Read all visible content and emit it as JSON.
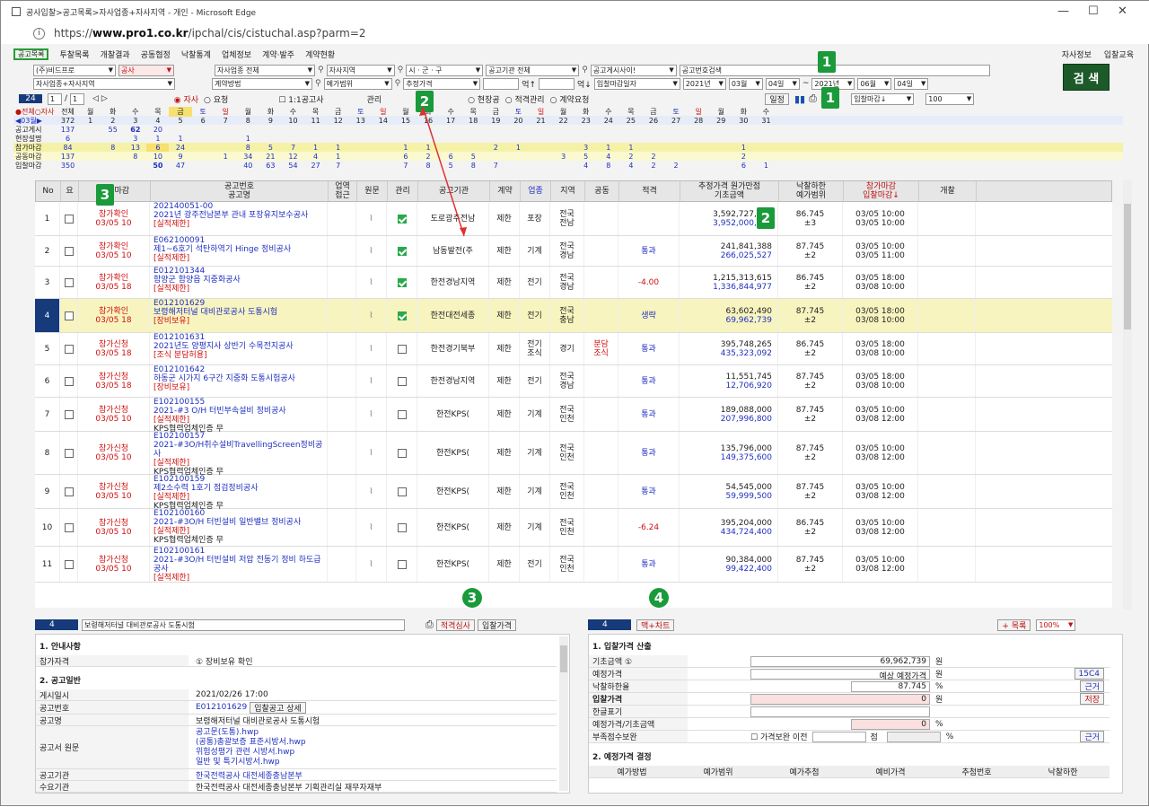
{
  "window": {
    "title": "공사입찰>공고목록>자사업종+자사지역 - 개인 - Microsoft Edge",
    "url_prefix": "https://",
    "url_host": "www.pro1.co.kr",
    "url_path": "/ipchal/cis/cistuchal.asp?parm=2"
  },
  "menu": [
    "공고목록",
    "투찰목록",
    "개찰결과",
    "공동협정",
    "낙찰통계",
    "업체정보",
    "계약·발주",
    "계약현황"
  ],
  "menu_right": [
    "자사정보",
    "입찰교육"
  ],
  "filters_row1": [
    "(주)비드프로",
    "공사",
    "자사업종 전체",
    "자사지역",
    "시 · 군 · 구",
    "공고기관 전체",
    "공고게시사이!",
    "공고번호검색"
  ],
  "filters_row2": [
    "자사업종+자사지역",
    "계약방법",
    "예가범위",
    "추정가격",
    "억↑",
    "억↓",
    "입찰마감일자",
    "2021년",
    "03월",
    "04일",
    "~",
    "2021년",
    "06월",
    "04일"
  ],
  "search_label": "검 색",
  "toolbar": {
    "count": "24",
    "page": "1",
    "pages": "1",
    "nav": "◁ ▷",
    "radio1": "자사",
    "radio2": "요청",
    "check1": "1:1공고사",
    "check2": "관리",
    "radio3": "현장공",
    "radio4": "적격관리",
    "radio5": "계약요청",
    "schedule": "일정",
    "sort": "입찰마감↓",
    "size": "100"
  },
  "badges": {
    "b1": "1",
    "b2": "2",
    "b3": "3",
    "b4": "4"
  },
  "calendar": {
    "dow": [
      "●전체○자사",
      "전체",
      "월",
      "화",
      "수",
      "목",
      "금",
      "토",
      "일",
      "월",
      "화",
      "수",
      "목",
      "금",
      "토",
      "일",
      "월",
      "화",
      "수",
      "목",
      "금",
      "토",
      "일",
      "월",
      "화",
      "수",
      "목",
      "금",
      "토",
      "일",
      "월",
      "화",
      "수"
    ],
    "days": [
      "◀03월▶",
      "372",
      "1",
      "2",
      "3",
      "4",
      "5",
      "6",
      "7",
      "8",
      "9",
      "10",
      "11",
      "12",
      "13",
      "14",
      "15",
      "16",
      "17",
      "18",
      "19",
      "20",
      "21",
      "22",
      "23",
      "24",
      "25",
      "26",
      "27",
      "28",
      "29",
      "30",
      "31"
    ],
    "rows": [
      {
        "label": "공고게시",
        "cells": [
          "137",
          "",
          "55",
          "62",
          "20",
          "",
          "",
          "",
          "",
          "",
          "",
          "",
          "",
          "",
          "",
          "",
          "",
          "",
          "",
          "",
          "",
          "",
          "",
          "",
          "",
          "",
          "",
          "",
          "",
          "",
          "",
          ""
        ]
      },
      {
        "label": "현장설명",
        "cells": [
          "6",
          "",
          "",
          "3",
          "1",
          "1",
          "",
          "",
          "1",
          "",
          "",
          "",
          "",
          "",
          "",
          "",
          "",
          "",
          "",
          "",
          "",
          "",
          "",
          "",
          "",
          "",
          "",
          "",
          "",
          "",
          "",
          ""
        ]
      },
      {
        "label": "참가마감",
        "cells": [
          "84",
          "",
          "8",
          "13",
          "6",
          "24",
          "",
          "",
          "8",
          "5",
          "7",
          "1",
          "1",
          "",
          "",
          "1",
          "1",
          "",
          "",
          "2",
          "1",
          "",
          "",
          "3",
          "1",
          "1",
          "",
          "",
          "",
          "",
          "1",
          ""
        ]
      },
      {
        "label": "공동마감",
        "cells": [
          "137",
          "",
          "",
          "8",
          "10",
          "9",
          "",
          "1",
          "34",
          "21",
          "12",
          "4",
          "1",
          "",
          "",
          "6",
          "2",
          "6",
          "5",
          "",
          "",
          "",
          "3",
          "5",
          "4",
          "2",
          "2",
          "",
          "",
          "",
          "2",
          ""
        ]
      },
      {
        "label": "입찰마감",
        "cells": [
          "350",
          "",
          "",
          "",
          "50",
          "47",
          "",
          "",
          "40",
          "63",
          "54",
          "27",
          "7",
          "",
          "",
          "7",
          "8",
          "5",
          "8",
          "7",
          "",
          "",
          "",
          "4",
          "8",
          "4",
          "2",
          "2",
          "",
          "",
          "6",
          "1"
        ]
      }
    ]
  },
  "columns": [
    "No",
    "요",
    "신청마감",
    "공고번호\n공고명",
    "업역\n접근",
    "원문",
    "관리",
    "공고기관",
    "계약",
    "업종",
    "지역",
    "공동",
    "적격",
    "추정가격 원가만점\n기초금액",
    "낙찰하한\n예가범위",
    "참가마감\n입찰마감↓",
    "개찰"
  ],
  "rows": [
    {
      "no": "1",
      "status": "참가확인",
      "date": "03/05 10",
      "id": "202140051-00",
      "name": "2021년 광주전남본부 관내 포장유지보수공사",
      "tag": "[실적제한]",
      "extra": "",
      "mgmt": true,
      "agency": "도로광주전남",
      "contract": "제한",
      "type": "포장",
      "region": "전국\n전남",
      "joint": "",
      "qual": "",
      "est": "3,592,727,273",
      "base": "3,952,000,000",
      "rate": "86.745",
      "range": "±3",
      "d1": "03/05 10:00",
      "d2": "03/05 10:00"
    },
    {
      "no": "2",
      "status": "참가확인",
      "date": "03/05 10",
      "id": "E062100091",
      "name": "제1~6호기 석탄하역기 Hinge 정비공사",
      "tag": "[실적제한]",
      "extra": "",
      "mgmt": true,
      "agency": "남동발전(주",
      "contract": "제한",
      "type": "기계",
      "region": "전국\n경남",
      "joint": "",
      "qual": "통과",
      "est": "241,841,388",
      "base": "266,025,527",
      "rate": "87.745",
      "range": "±2",
      "d1": "03/05 10:00",
      "d2": "03/05 11:00"
    },
    {
      "no": "3",
      "status": "참가확인",
      "date": "03/05 18",
      "id": "E012101344",
      "name": "함양군 함양읍 지중화공사",
      "tag": "[실적제한]",
      "extra": "",
      "mgmt": true,
      "agency": "한전경남지역",
      "contract": "제한",
      "type": "전기",
      "region": "전국\n경남",
      "joint": "",
      "qual": "-4.00",
      "est": "1,215,313,615",
      "base": "1,336,844,977",
      "rate": "86.745",
      "range": "±2",
      "d1": "03/05 18:00",
      "d2": "03/08 10:00"
    },
    {
      "no": "4",
      "status": "참가확인",
      "date": "03/05 18",
      "id": "E012101629",
      "name": "보령해저터널 대비관로공사 도통시험",
      "tag": "[장비보유]",
      "extra": "",
      "mgmt": true,
      "agency": "한전대전세종",
      "contract": "제한",
      "type": "전기",
      "region": "전국\n충남",
      "joint": "",
      "qual": "생략",
      "est": "63,602,490",
      "base": "69,962,739",
      "rate": "87.745",
      "range": "±2",
      "d1": "03/05 18:00",
      "d2": "03/08 10:00"
    },
    {
      "no": "5",
      "status": "참가신청",
      "date": "03/05 18",
      "id": "E012101631",
      "name": "2021년도 양평지사 상반기 수목전지공사",
      "tag": "[조식 분담허용]",
      "extra": "",
      "mgmt": false,
      "agency": "한전경기북부",
      "contract": "제한",
      "type": "전기\n조식",
      "region": "경기",
      "joint": "분담\n조식",
      "qual": "통과",
      "est": "395,748,265",
      "base": "435,323,092",
      "rate": "86.745",
      "range": "±2",
      "d1": "03/05 18:00",
      "d2": "03/08 10:00"
    },
    {
      "no": "6",
      "status": "참가신청",
      "date": "03/05 18",
      "id": "E012101642",
      "name": "하동군 시가지 6구간 지중화 도통시험공사",
      "tag": "[장비보유]",
      "extra": "",
      "mgmt": false,
      "agency": "한전경남지역",
      "contract": "제한",
      "type": "전기",
      "region": "전국\n경남",
      "joint": "",
      "qual": "통과",
      "est": "11,551,745",
      "base": "12,706,920",
      "rate": "87.745",
      "range": "±2",
      "d1": "03/05 18:00",
      "d2": "03/08 10:00"
    },
    {
      "no": "7",
      "status": "참가신청",
      "date": "03/05 10",
      "id": "E102100155",
      "name": "2021-#3 O/H 터빈부속설비 정비공사",
      "tag": "[실적제한]",
      "extra": "KPS협력업체인증 무",
      "mgmt": false,
      "agency": "한전KPS(",
      "contract": "제한",
      "type": "기계",
      "region": "전국\n인천",
      "joint": "",
      "qual": "통과",
      "est": "189,088,000",
      "base": "207,996,800",
      "rate": "87.745",
      "range": "±2",
      "d1": "03/05 10:00",
      "d2": "03/08 12:00"
    },
    {
      "no": "8",
      "status": "참가신청",
      "date": "03/05 10",
      "id": "E102100157",
      "name": "2021-#3O/H취수설비TravellingScreen정비공사",
      "tag": "[실적제한]",
      "extra": "KPS협력업체인증 무",
      "mgmt": false,
      "agency": "한전KPS(",
      "contract": "제한",
      "type": "기계",
      "region": "전국\n인천",
      "joint": "",
      "qual": "통과",
      "est": "135,796,000",
      "base": "149,375,600",
      "rate": "87.745",
      "range": "±2",
      "d1": "03/05 10:00",
      "d2": "03/08 12:00"
    },
    {
      "no": "9",
      "status": "참가신청",
      "date": "03/05 10",
      "id": "E102100159",
      "name": "제2소수력 1호기 점검정비공사",
      "tag": "[실적제한]",
      "extra": "KPS협력업체인증 무",
      "mgmt": false,
      "agency": "한전KPS(",
      "contract": "제한",
      "type": "기계",
      "region": "전국\n인천",
      "joint": "",
      "qual": "통과",
      "est": "54,545,000",
      "base": "59,999,500",
      "rate": "87.745",
      "range": "±2",
      "d1": "03/05 10:00",
      "d2": "03/08 12:00"
    },
    {
      "no": "10",
      "status": "참가신청",
      "date": "03/05 10",
      "id": "E102100160",
      "name": "2021-#3O/H 터빈설비 일반밸브 정비공사",
      "tag": "[실적제한]",
      "extra": "KPS협력업체인증 무",
      "mgmt": false,
      "agency": "한전KPS(",
      "contract": "제한",
      "type": "기계",
      "region": "전국\n인천",
      "joint": "",
      "qual": "-6.24",
      "est": "395,204,000",
      "base": "434,724,400",
      "rate": "86.745",
      "range": "±2",
      "d1": "03/05 10:00",
      "d2": "03/08 12:00"
    },
    {
      "no": "11",
      "status": "참가신청",
      "date": "03/05 10",
      "id": "E102100161",
      "name": "2021-#3O/H 터빈설비 저압 전동기 정비 하도급공사",
      "tag": "[실적제한]",
      "extra": "",
      "mgmt": false,
      "agency": "한전KPS(",
      "contract": "제한",
      "type": "전기",
      "region": "전국\n인천",
      "joint": "",
      "qual": "통과",
      "est": "90,384,000",
      "base": "99,422,400",
      "rate": "87.745",
      "range": "±2",
      "d1": "03/05 10:00",
      "d2": "03/08 12:00"
    }
  ],
  "left_panel": {
    "num": "4",
    "title": "보령해저터널 대비관로공사 도통시험",
    "btn1": "적격심사",
    "btn2": "입찰가격",
    "s1": "1. 안내사항",
    "s1_k": "참가자격",
    "s1_v": "① 장비보유 확인",
    "s2": "2. 공고일반",
    "items": [
      {
        "k": "게시일시",
        "v": "2021/02/26 17:00"
      },
      {
        "k": "공고번호",
        "v": "E012101629"
      },
      {
        "k": "공고명",
        "v": "보령해저터널 대비관로공사 도통시험"
      }
    ],
    "detail_btn": "입찰공고 상세",
    "docs_k": "공고서 원문",
    "docs": [
      "공고문(도통).hwp",
      "(공통)총괄보증 표준시방서.hwp",
      "위험성평가 관련 시방서.hwp",
      "일반 및 특기시방서.hwp"
    ],
    "agency_k": "공고기관",
    "agency_v": "한국전력공사 대전세종충남본부",
    "demand_k": "수요기관",
    "demand_v": "한국전력공사 대전세종충남본부 기획관리실 재무자재부"
  },
  "right_panel": {
    "num": "4",
    "btn": "맥+차트",
    "list_btn": "+ 목록",
    "zoom": "100%",
    "s1": "1. 입찰가격 산출",
    "rows": [
      {
        "k": "기초금액 ①",
        "v": "69,962,739",
        "u": "원"
      },
      {
        "k": "예정가격",
        "v": "예상 예정가격",
        "u": "원",
        "b": "15C4"
      },
      {
        "k": "낙찰하한율",
        "v": "87.745",
        "u": "%",
        "b": "근거"
      },
      {
        "k": "입찰가격",
        "v": "0",
        "u": "원",
        "b": "저장"
      },
      {
        "k": "한글표기",
        "v": "",
        "u": ""
      },
      {
        "k": "예정가격/기초금액",
        "v": "0",
        "u": "%"
      },
      {
        "k": "부족점수보완",
        "v": "",
        "u": "%",
        "b": "근거"
      }
    ],
    "chk_label": "가격보완 이전",
    "pt": "점",
    "s2": "2. 예정가격 결정",
    "cols": [
      "예가방법",
      "예가범위",
      "예가추첨",
      "예비가격",
      "추첨번호",
      "낙찰하한"
    ]
  }
}
